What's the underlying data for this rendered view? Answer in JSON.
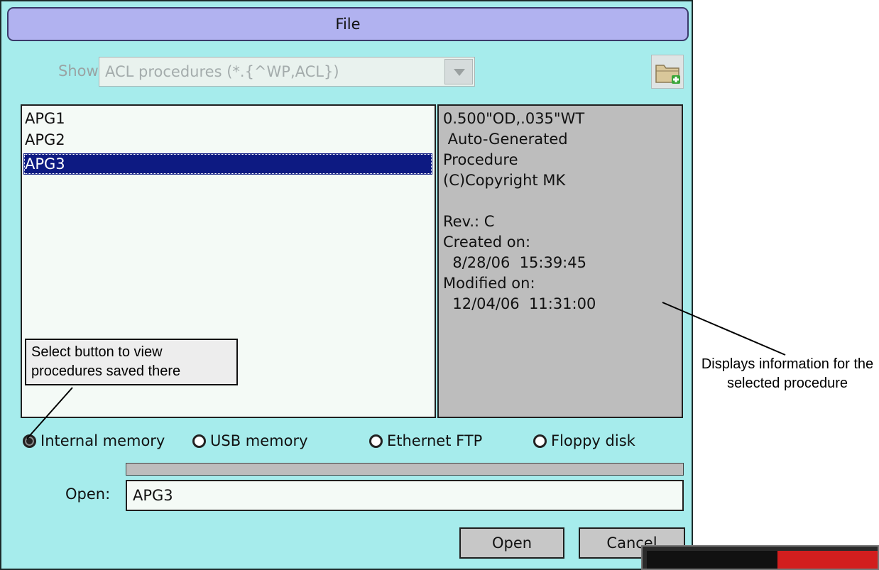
{
  "dialog": {
    "title": "File",
    "show": {
      "label": "Show:",
      "value": "ACL procedures (*.{^WP,ACL})"
    },
    "new_folder_icon": "folder-add-icon",
    "files": [
      {
        "name": "APG1",
        "selected": false
      },
      {
        "name": "APG2",
        "selected": false
      },
      {
        "name": "APG3",
        "selected": true
      }
    ],
    "info_text": "0.500\"OD,.035\"WT\n Auto-Generated\nProcedure\n(C)Copyright MK\n\nRev.: C\nCreated on:\n  8/28/06  15:39:45\nModified on:\n  12/04/06  11:31:00",
    "locations": [
      {
        "label": "Internal memory",
        "selected": true
      },
      {
        "label": "USB memory",
        "selected": false
      },
      {
        "label": "Ethernet FTP",
        "selected": false
      },
      {
        "label": "Floppy disk",
        "selected": false
      }
    ],
    "open_label": "Open:",
    "open_value": "APG3",
    "buttons": {
      "open": "Open",
      "cancel": "Cancel"
    }
  },
  "annotations": {
    "locations_note": "Select button to view procedures saved there",
    "info_note": "Displays information for the selected procedure"
  },
  "colors": {
    "dialog_bg": "#a6ecec",
    "titlebar": "#b1b2f0",
    "selection": "#0d1a82",
    "info_panel": "#bdbdbd"
  }
}
